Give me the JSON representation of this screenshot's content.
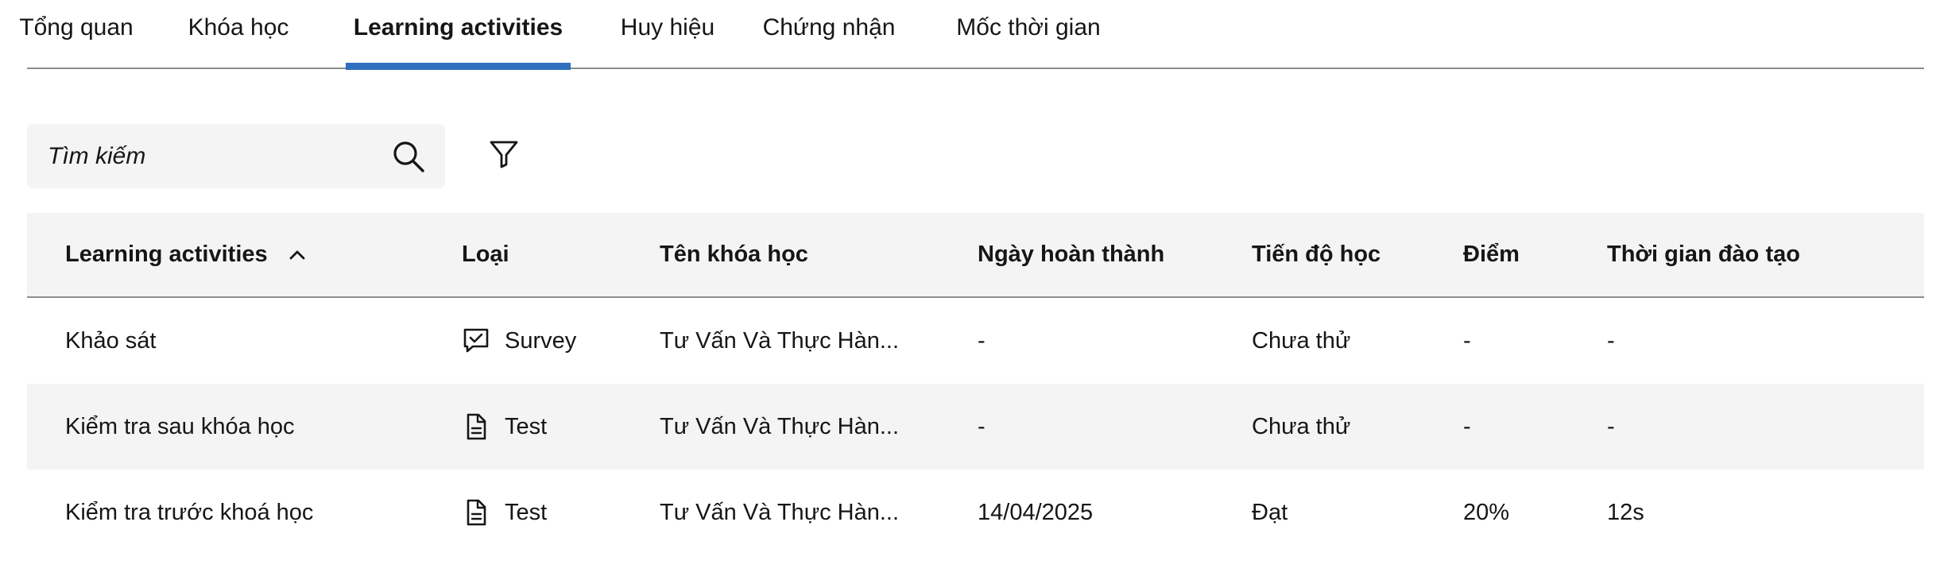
{
  "tabs": [
    {
      "label": "Tổng quan",
      "active": false
    },
    {
      "label": "Khóa học",
      "active": false
    },
    {
      "label": "Learning activities",
      "active": true
    },
    {
      "label": "Huy hiệu",
      "active": false
    },
    {
      "label": "Chứng nhận",
      "active": false
    },
    {
      "label": "Mốc thời gian",
      "active": false
    }
  ],
  "search": {
    "placeholder": "Tìm kiếm",
    "icon": "search-icon"
  },
  "filter": {
    "icon": "filter-icon"
  },
  "table": {
    "columns": [
      "Learning activities",
      "Loại",
      "Tên khóa học",
      "Ngày hoàn thành",
      "Tiến độ học",
      "Điểm",
      "Thời gian đào tạo"
    ],
    "sort": {
      "column": "Learning activities",
      "direction": "ascending",
      "icon": "chevron-up-icon"
    },
    "rows": [
      {
        "activity": "Khảo sát",
        "type": "Survey",
        "type_icon": "survey-icon",
        "course": "Tư Vấn Và Thực Hàn...",
        "completed_date": "-",
        "progress": "Chưa thử",
        "score": "-",
        "training_time": "-"
      },
      {
        "activity": "Kiểm tra sau khóa học",
        "type": "Test",
        "type_icon": "document-icon",
        "course": "Tư Vấn Và Thực Hàn...",
        "completed_date": "-",
        "progress": "Chưa thử",
        "score": "-",
        "training_time": "-"
      },
      {
        "activity": "Kiểm tra trước khoá học",
        "type": "Test",
        "type_icon": "document-icon",
        "course": "Tư Vấn Và Thực Hàn...",
        "completed_date": "14/04/2025",
        "progress": "Đạt",
        "score": "20%",
        "training_time": "12s"
      }
    ]
  },
  "colors": {
    "accent": "#2f6fbe",
    "header_bg": "#f4f4f4",
    "stripe_bg": "#f4f4f4",
    "divider": "#8d8d8d",
    "text": "#161616"
  }
}
